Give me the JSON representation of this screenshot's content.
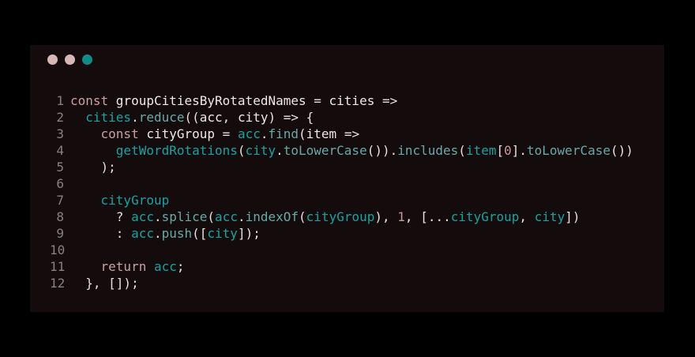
{
  "window": {
    "buttons": [
      {
        "color": "#d9b6b6"
      },
      {
        "color": "#d9b6b6"
      },
      {
        "color": "#118c86"
      }
    ]
  },
  "code": {
    "lines": [
      {
        "num": "1",
        "tokens": [
          [
            "kw",
            "const "
          ],
          [
            "id",
            "groupCitiesByRotatedNames"
          ],
          [
            "pn",
            " = "
          ],
          [
            "id",
            "cities"
          ],
          [
            "pn",
            " =>"
          ]
        ]
      },
      {
        "num": "2",
        "tokens": [
          [
            "pn",
            "  "
          ],
          [
            "tl",
            "cities"
          ],
          [
            "pn",
            "."
          ],
          [
            "mt",
            "reduce"
          ],
          [
            "pn",
            "(("
          ],
          [
            "id",
            "acc"
          ],
          [
            "pn",
            ", "
          ],
          [
            "id",
            "city"
          ],
          [
            "pn",
            ") => {"
          ]
        ]
      },
      {
        "num": "3",
        "tokens": [
          [
            "pn",
            "    "
          ],
          [
            "kw",
            "const "
          ],
          [
            "id",
            "cityGroup"
          ],
          [
            "pn",
            " = "
          ],
          [
            "tl",
            "acc"
          ],
          [
            "pn",
            "."
          ],
          [
            "mt",
            "find"
          ],
          [
            "pn",
            "("
          ],
          [
            "id",
            "item"
          ],
          [
            "pn",
            " =>"
          ]
        ]
      },
      {
        "num": "4",
        "tokens": [
          [
            "pn",
            "      "
          ],
          [
            "tl",
            "getWordRotations"
          ],
          [
            "pn",
            "("
          ],
          [
            "tl",
            "city"
          ],
          [
            "pn",
            "."
          ],
          [
            "mt",
            "toLowerCase"
          ],
          [
            "pn",
            "())."
          ],
          [
            "mt",
            "includes"
          ],
          [
            "pn",
            "("
          ],
          [
            "tl",
            "item"
          ],
          [
            "pn",
            "["
          ],
          [
            "nm",
            "0"
          ],
          [
            "pn",
            "]."
          ],
          [
            "mt",
            "toLowerCase"
          ],
          [
            "pn",
            "())"
          ]
        ]
      },
      {
        "num": "5",
        "tokens": [
          [
            "pn",
            "    );"
          ]
        ]
      },
      {
        "num": "6",
        "tokens": [
          [
            "pn",
            ""
          ]
        ]
      },
      {
        "num": "7",
        "tokens": [
          [
            "pn",
            "    "
          ],
          [
            "tl",
            "cityGroup"
          ]
        ]
      },
      {
        "num": "8",
        "tokens": [
          [
            "pn",
            "      ? "
          ],
          [
            "tl",
            "acc"
          ],
          [
            "pn",
            "."
          ],
          [
            "mt",
            "splice"
          ],
          [
            "pn",
            "("
          ],
          [
            "tl",
            "acc"
          ],
          [
            "pn",
            "."
          ],
          [
            "mt",
            "indexOf"
          ],
          [
            "pn",
            "("
          ],
          [
            "tl",
            "cityGroup"
          ],
          [
            "pn",
            "), "
          ],
          [
            "nm",
            "1"
          ],
          [
            "pn",
            ", [..."
          ],
          [
            "tl",
            "cityGroup"
          ],
          [
            "pn",
            ", "
          ],
          [
            "tl",
            "city"
          ],
          [
            "pn",
            "])"
          ]
        ]
      },
      {
        "num": "9",
        "tokens": [
          [
            "pn",
            "      : "
          ],
          [
            "tl",
            "acc"
          ],
          [
            "pn",
            "."
          ],
          [
            "mt",
            "push"
          ],
          [
            "pn",
            "(["
          ],
          [
            "tl",
            "city"
          ],
          [
            "pn",
            "]);"
          ]
        ]
      },
      {
        "num": "10",
        "tokens": [
          [
            "pn",
            ""
          ]
        ]
      },
      {
        "num": "11",
        "tokens": [
          [
            "pn",
            "    "
          ],
          [
            "kw",
            "return "
          ],
          [
            "tl",
            "acc"
          ],
          [
            "pn",
            ";"
          ]
        ]
      },
      {
        "num": "12",
        "tokens": [
          [
            "pn",
            "  }, []);"
          ]
        ]
      }
    ]
  }
}
